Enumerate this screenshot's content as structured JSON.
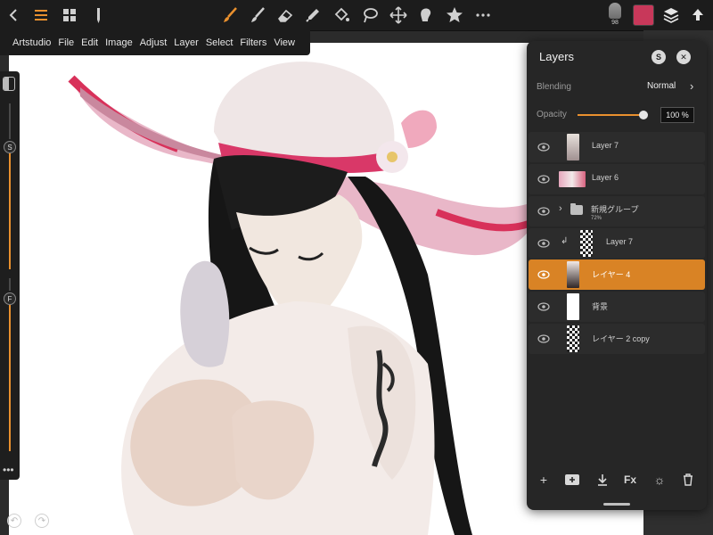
{
  "menu": {
    "items": [
      "Artstudio",
      "File",
      "Edit",
      "Image",
      "Adjust",
      "Layer",
      "Select",
      "Filters",
      "View"
    ]
  },
  "toolbar": {
    "brush_size": "98",
    "current_color": "#c8385a",
    "accent": "#e9902e"
  },
  "layers_panel": {
    "title": "Layers",
    "blending_label": "Blending",
    "blending_value": "Normal",
    "opacity_label": "Opacity",
    "opacity_value": "100 %",
    "opacity_fraction": 1.0,
    "layers": [
      {
        "name": "Layer 7",
        "visible": true,
        "selected": false,
        "thumb": "figure"
      },
      {
        "name": "Layer 6",
        "visible": true,
        "selected": false,
        "thumb": "hat"
      },
      {
        "name": "新規グループ",
        "sub": "72%",
        "visible": true,
        "selected": false,
        "type": "group"
      },
      {
        "name": "Layer 7",
        "visible": true,
        "selected": false,
        "thumb": "checker",
        "clipped": true
      },
      {
        "name": "レイヤー 4",
        "visible": true,
        "selected": true,
        "thumb": "figure-dark"
      },
      {
        "name": "背景",
        "visible": true,
        "selected": false,
        "thumb": "white"
      },
      {
        "name": "レイヤー 2 copy",
        "visible": true,
        "selected": false,
        "thumb": "checker"
      }
    ]
  }
}
